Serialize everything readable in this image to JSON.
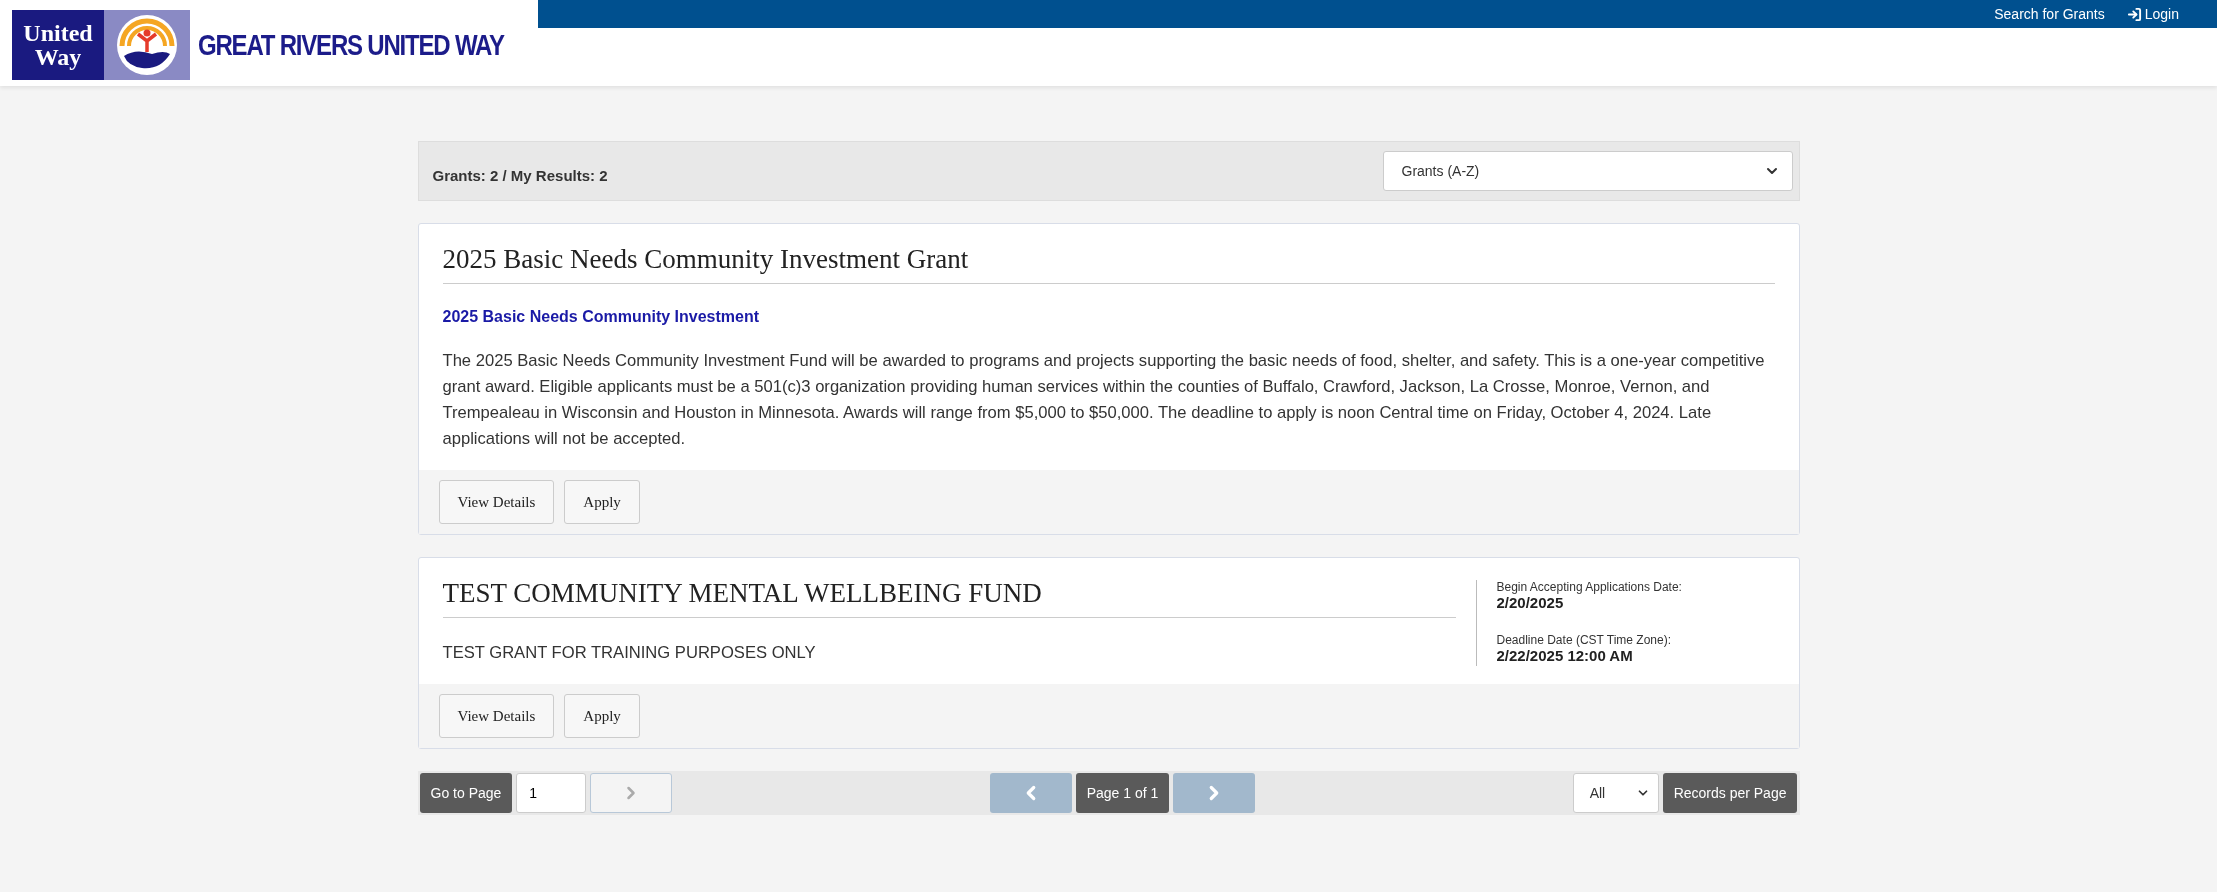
{
  "header": {
    "logo": {
      "words": [
        "United",
        "Way"
      ]
    },
    "org_name": "GREAT RIVERS UNITED WAY",
    "nav": [
      {
        "kind": "link",
        "label": "Search for Grants"
      },
      {
        "kind": "login",
        "label": "Login"
      }
    ]
  },
  "results_bar": {
    "summary": "Grants: 2 / My Results: 2",
    "sort": {
      "value": "Grants (A-Z)"
    }
  },
  "grants": [
    {
      "title": "2025 Basic Needs Community Investment Grant",
      "subtitle": "2025 Basic Needs Community Investment",
      "description": "The 2025 Basic Needs Community Investment Fund will be awarded to programs and projects supporting the basic needs of food, shelter, and safety. This is a one-year competitive grant award. Eligible applicants must be a 501(c)3 organization providing human services within the counties of Buffalo, Crawford, Jackson, La Crosse, Monroe, Vernon, and Trempealeau in Wisconsin and Houston in Minnesota. Awards will range from $5,000 to $50,000. The deadline to apply is noon Central time on Friday, October 4, 2024. Late applications will not be accepted.",
      "buttons": [
        "View Details",
        "Apply"
      ]
    },
    {
      "title": "TEST COMMUNITY MENTAL WELLBEING FUND",
      "description": "TEST GRANT FOR TRAINING PURPOSES ONLY",
      "dates": [
        {
          "label": "Begin Accepting Applications Date:",
          "value": "2/20/2025"
        },
        {
          "label": "Deadline Date (CST Time Zone):",
          "value": "2/22/2025 12:00 AM"
        }
      ],
      "buttons": [
        "View Details",
        "Apply"
      ]
    }
  ],
  "pager": {
    "go_label": "Go to Page",
    "page_value": "1",
    "prev_disabled": true,
    "page_info": "Page 1 of 1",
    "next_disabled": true,
    "per_page": {
      "value": "All"
    },
    "per_page_label": "Records per Page"
  }
}
